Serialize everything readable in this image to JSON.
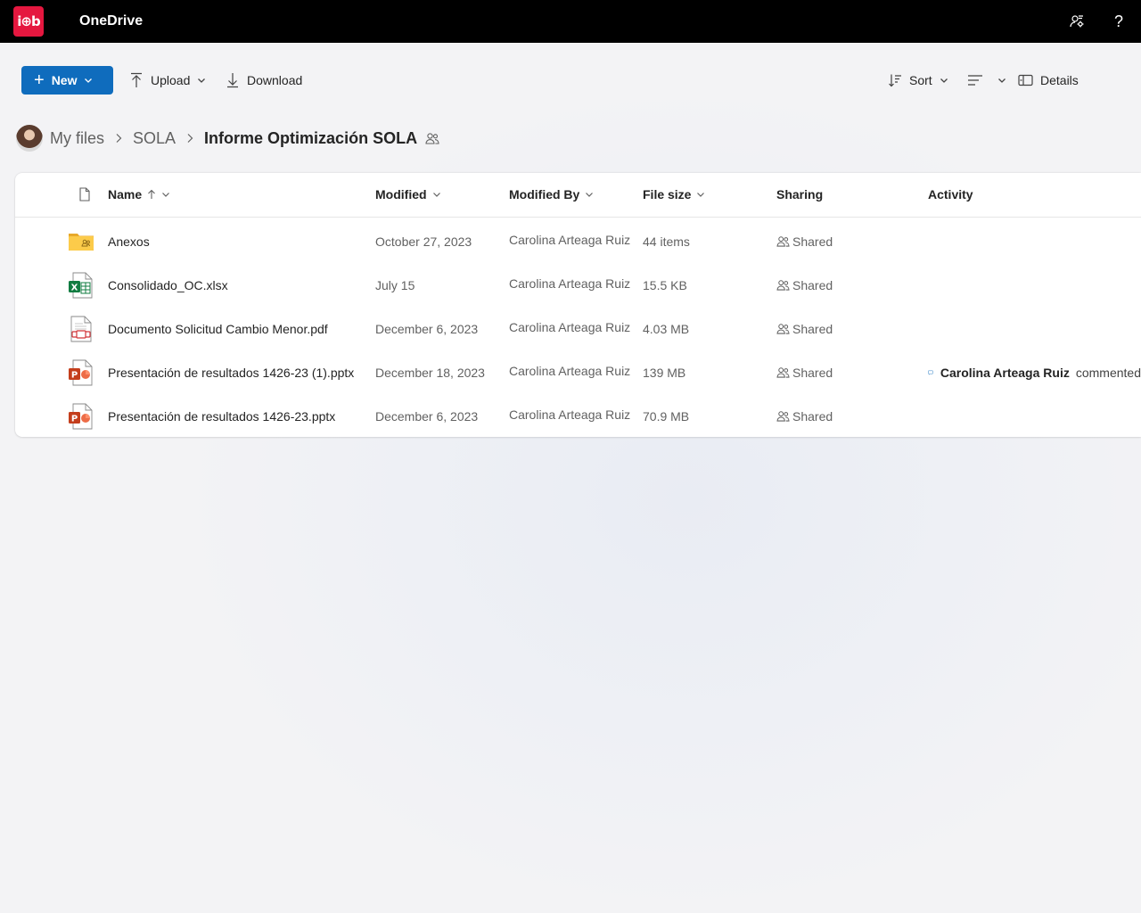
{
  "app": {
    "logo_text": "i⊕b",
    "title": "OneDrive"
  },
  "top_icons": [
    "people-settings-icon",
    "help-icon"
  ],
  "help_glyph": "?",
  "toolbar": {
    "new_label": "New",
    "upload_label": "Upload",
    "download_label": "Download",
    "sort_label": "Sort",
    "details_label": "Details"
  },
  "breadcrumb": {
    "items": [
      "My files",
      "SOLA"
    ],
    "current": "Informe Optimización SOLA"
  },
  "table": {
    "columns": {
      "name": "Name",
      "modified": "Modified",
      "modified_by": "Modified By",
      "file_size": "File size",
      "sharing": "Sharing",
      "activity": "Activity"
    },
    "rows": [
      {
        "icon": "shared-folder-icon",
        "name": "Anexos",
        "modified": "October 27, 2023",
        "modified_by": "Carolina Arteaga Ruiz",
        "size": "44 items",
        "sharing": "Shared",
        "activity_user": "",
        "activity_text": ""
      },
      {
        "icon": "excel-file-icon",
        "name": "Consolidado_OC.xlsx",
        "modified": "July 15",
        "modified_by": "Carolina Arteaga Ruiz",
        "size": "15.5 KB",
        "sharing": "Shared",
        "activity_user": "",
        "activity_text": ""
      },
      {
        "icon": "pdf-file-icon",
        "name": "Documento Solicitud Cambio Menor.pdf",
        "modified": "December 6, 2023",
        "modified_by": "Carolina Arteaga Ruiz",
        "size": "4.03 MB",
        "sharing": "Shared",
        "activity_user": "",
        "activity_text": ""
      },
      {
        "icon": "powerpoint-file-icon",
        "name": "Presentación de resultados 1426-23 (1).pptx",
        "modified": "December 18, 2023",
        "modified_by": "Carolina Arteaga Ruiz",
        "size": "139 MB",
        "sharing": "Shared",
        "activity_user": "Carolina Arteaga Ruiz",
        "activity_text": "commented"
      },
      {
        "icon": "powerpoint-file-icon",
        "name": "Presentación de resultados 1426-23.pptx",
        "modified": "December 6, 2023",
        "modified_by": "Carolina Arteaga Ruiz",
        "size": "70.9 MB",
        "sharing": "Shared",
        "activity_user": "",
        "activity_text": ""
      }
    ]
  },
  "colors": {
    "accent": "#0f6cbd",
    "logo": "#e5173f",
    "topbar": "#000000"
  }
}
